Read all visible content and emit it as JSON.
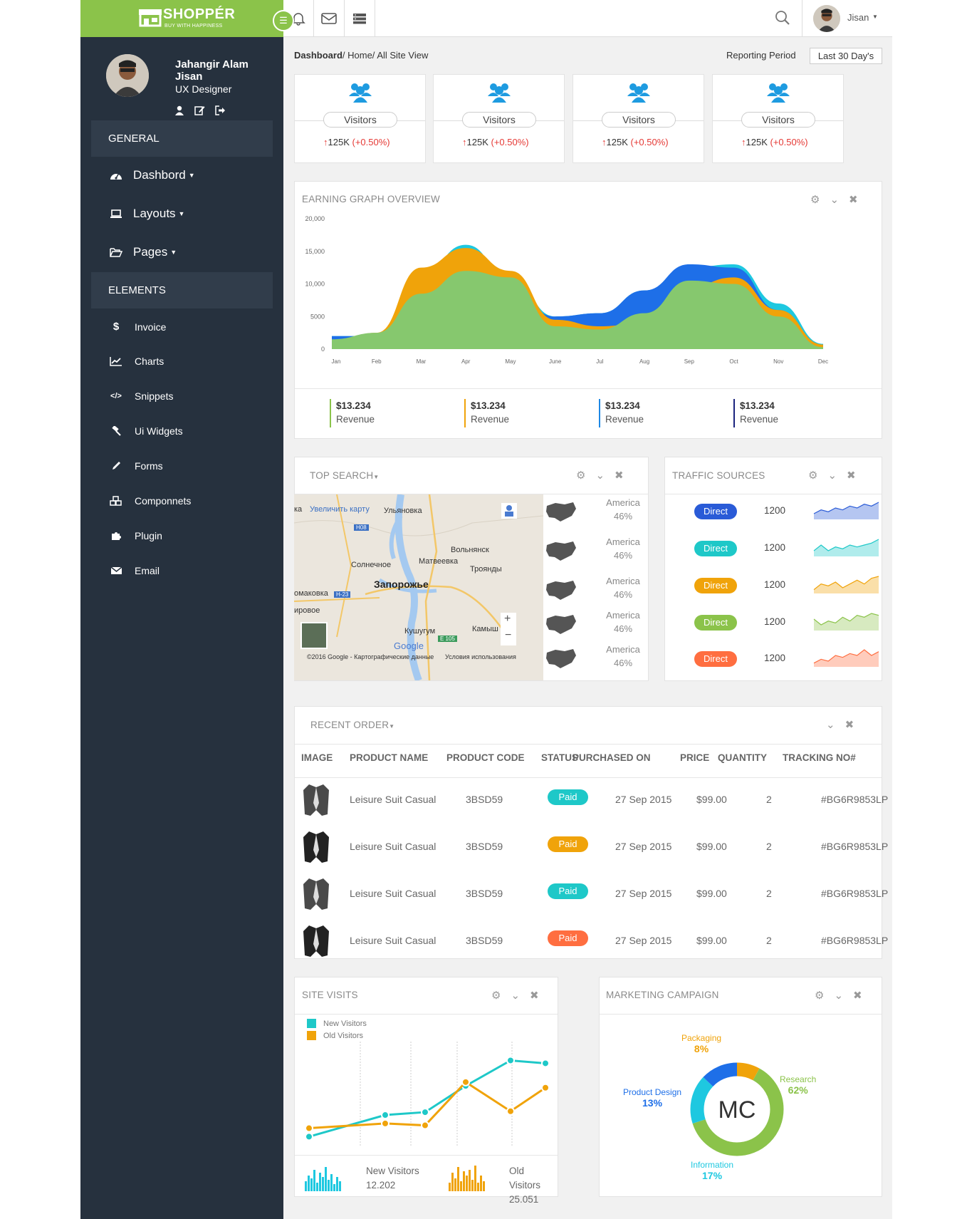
{
  "brand": {
    "name": "SHOPPÉR",
    "tagline": "BUY WITH HAPPINESS"
  },
  "profile": {
    "name": "Jahangir Alam Jisan",
    "role": "UX Designer"
  },
  "sidebar": {
    "general_label": "GENERAL",
    "elements_label": "ELEMENTS",
    "general_items": [
      {
        "label": "Dashbord",
        "icon": "dashboard-icon"
      },
      {
        "label": "Layouts",
        "icon": "laptop-icon"
      },
      {
        "label": "Pages",
        "icon": "folder-open-icon"
      }
    ],
    "element_items": [
      {
        "label": "Invoice",
        "icon": "dollar-icon"
      },
      {
        "label": "Charts",
        "icon": "line-chart-icon"
      },
      {
        "label": "Snippets",
        "icon": "code-icon"
      },
      {
        "label": "Ui Widgets",
        "icon": "gavel-icon"
      },
      {
        "label": "Forms",
        "icon": "pencil-icon"
      },
      {
        "label": "Componnets",
        "icon": "cubes-icon"
      },
      {
        "label": "Plugin",
        "icon": "puzzle-icon"
      },
      {
        "label": "Email",
        "icon": "envelope-icon"
      }
    ]
  },
  "topbar": {
    "user": "Jisan"
  },
  "breadcrumb": {
    "current": "Dashboard",
    "rest": "/ Home/ All Site View"
  },
  "reporting": {
    "label": "Reporting Period",
    "selected": "Last 30 Day's"
  },
  "visitors": [
    {
      "label": "Visitors",
      "value": "125K",
      "change": "(+0.50%)"
    },
    {
      "label": "Visitors",
      "value": "125K",
      "change": "(+0.50%)"
    },
    {
      "label": "Visitors",
      "value": "125K",
      "change": "(+0.50%)"
    },
    {
      "label": "Visitors",
      "value": "125K",
      "change": "(+0.50%)"
    }
  ],
  "earning": {
    "title": "EARNING GRAPH OVERVIEW",
    "revenue": [
      {
        "amount": "$13.234",
        "label": "Revenue",
        "color": "#8bc34a"
      },
      {
        "amount": "$13.234",
        "label": "Revenue",
        "color": "#f0a30a"
      },
      {
        "amount": "$13.234",
        "label": "Revenue",
        "color": "#1e88e5"
      },
      {
        "amount": "$13.234",
        "label": "Revenue",
        "color": "#1a237e"
      }
    ]
  },
  "chart_data": [
    {
      "type": "area",
      "title": "EARNING GRAPH OVERVIEW",
      "categories": [
        "Jan",
        "Feb",
        "Mar",
        "Apr",
        "May",
        "June",
        "Jul",
        "Aug",
        "Sep",
        "Oct",
        "Nov",
        "Dec"
      ],
      "y_ticks": [
        "20,000",
        "15,000",
        "10,000",
        "5000",
        "0"
      ],
      "ylim": [
        0,
        20000
      ],
      "series": [
        {
          "color": "#1ec8e0",
          "values": [
            2000,
            2000,
            11500,
            16000,
            10800,
            5000,
            5500,
            9000,
            12500,
            13000,
            7000,
            800
          ]
        },
        {
          "color": "#1e6fe8",
          "values": [
            2000,
            2000,
            11500,
            15000,
            9000,
            5000,
            5500,
            9000,
            13000,
            12500,
            6000,
            700
          ]
        },
        {
          "color": "#f0a30a",
          "values": [
            1200,
            2500,
            12500,
            15500,
            12000,
            4500,
            3500,
            4000,
            9500,
            11000,
            6000,
            700
          ]
        },
        {
          "color": "#86c86e",
          "values": [
            1500,
            2500,
            8500,
            12000,
            11000,
            3500,
            3000,
            5500,
            10500,
            10000,
            5000,
            300
          ]
        }
      ]
    },
    {
      "type": "line",
      "title": "SITE VISITS",
      "series": [
        {
          "name": "New Visitors",
          "color": "#1ec8c8",
          "values": [
            5,
            28,
            31,
            59,
            86,
            83
          ]
        },
        {
          "name": "Old Visitors",
          "color": "#f0a30a",
          "values": [
            14,
            19,
            17,
            63,
            32,
            57
          ]
        }
      ]
    },
    {
      "type": "pie",
      "title": "MARKETING CAMPAIGN",
      "center_label": "MC",
      "slices": [
        {
          "label": "Packaging",
          "value": 8,
          "color": "#f0a30a"
        },
        {
          "label": "Research",
          "value": 62,
          "color": "#8bc34a"
        },
        {
          "label": "Information",
          "value": 17,
          "color": "#1ec8e0"
        },
        {
          "label": "Product Design",
          "value": 13,
          "color": "#1e6fe8"
        }
      ]
    }
  ],
  "top_search": {
    "title": "TOP SEARCH",
    "map": {
      "enlarge": "Увеличить карту",
      "cities": [
        "Ульяновка",
        "Вольнянск",
        "Матвеевка",
        "Солнечное",
        "Троянды",
        "Запорожье",
        "омаковка",
        "ировое",
        "Кушугум",
        "Камыш"
      ],
      "roads": [
        "H08",
        "H-23",
        "E 105"
      ],
      "google": "Google",
      "copyright": "©2016 Google - Картографические данные",
      "terms": "Условия использования"
    },
    "countries": [
      {
        "name": "America",
        "percent": "46%"
      },
      {
        "name": "America",
        "percent": "46%"
      },
      {
        "name": "America",
        "percent": "46%"
      },
      {
        "name": "America",
        "percent": "46%"
      },
      {
        "name": "America",
        "percent": "46%"
      }
    ]
  },
  "traffic": {
    "title": "TRAFFIC SOURCES",
    "rows": [
      {
        "label": "Direct",
        "value": "1200",
        "color": "#2a5bd7",
        "spark": [
          3,
          5,
          4,
          6,
          5,
          7,
          6,
          8,
          7,
          9
        ]
      },
      {
        "label": "Direct",
        "value": "1200",
        "color": "#1ec8c8",
        "spark": [
          3,
          6,
          3,
          5,
          4,
          6,
          5,
          6,
          7,
          9
        ]
      },
      {
        "label": "Direct",
        "value": "1200",
        "color": "#f0a30a",
        "spark": [
          2,
          5,
          4,
          6,
          3,
          5,
          7,
          5,
          8,
          9
        ]
      },
      {
        "label": "Direct",
        "value": "1200",
        "color": "#8bc34a",
        "spark": [
          6,
          3,
          5,
          4,
          7,
          5,
          8,
          7,
          9,
          8
        ]
      },
      {
        "label": "Direct",
        "value": "1200",
        "color": "#ff6e40",
        "spark": [
          2,
          4,
          3,
          6,
          5,
          7,
          6,
          9,
          6,
          8
        ]
      }
    ]
  },
  "orders": {
    "title": "RECENT ORDER",
    "headers": [
      "IMAGE",
      "PRODUCT NAME",
      "PRODUCT CODE",
      "STATUS",
      "PURCHASED ON",
      "PRICE",
      "QUANTITY",
      "TRACKING NO#"
    ],
    "rows": [
      {
        "name": "Leisure Suit Casual",
        "code": "3BSD59",
        "status": "Paid",
        "status_color": "#1ec8c8",
        "date": "27 Sep 2015",
        "price": "$99.00",
        "qty": "2",
        "tracking": "#BG6R9853LP"
      },
      {
        "name": "Leisure Suit Casual",
        "code": "3BSD59",
        "status": "Paid",
        "status_color": "#f0a30a",
        "date": "27 Sep 2015",
        "price": "$99.00",
        "qty": "2",
        "tracking": "#BG6R9853LP"
      },
      {
        "name": "Leisure Suit Casual",
        "code": "3BSD59",
        "status": "Paid",
        "status_color": "#1ec8c8",
        "date": "27 Sep 2015",
        "price": "$99.00",
        "qty": "2",
        "tracking": "#BG6R9853LP"
      },
      {
        "name": "Leisure Suit Casual",
        "code": "3BSD59",
        "status": "Paid",
        "status_color": "#ff6e40",
        "date": "27 Sep 2015",
        "price": "$99.00",
        "qty": "2",
        "tracking": "#BG6R9853LP"
      }
    ]
  },
  "site_visits": {
    "title": "SITE VISITS",
    "legend": [
      {
        "label": "New Visitors",
        "color": "#1ec8c8"
      },
      {
        "label": "Old Visitors",
        "color": "#f0a30a"
      }
    ],
    "stats": [
      {
        "label": "New Visitors",
        "value": "12.202",
        "color": "#1ec8e0"
      },
      {
        "label": "Old Visitors",
        "value": "25.051",
        "color": "#f0a30a"
      }
    ]
  },
  "marketing": {
    "title": "MARKETING CAMPAIGN"
  }
}
